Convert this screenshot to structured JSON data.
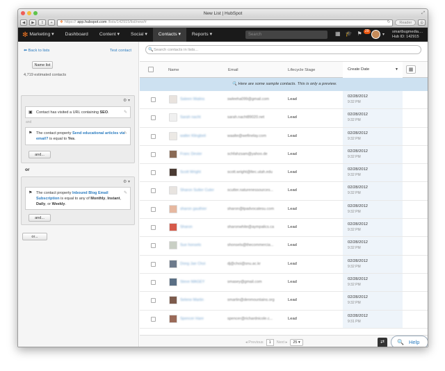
{
  "window": {
    "title": "New List | HubSpot"
  },
  "browser": {
    "protocol": "https://",
    "domain": "app.hubspot.com",
    "path": "/lists/142915/list/new/#",
    "reader_label": "Reader",
    "back": "◀",
    "forward": "▶",
    "add": "+"
  },
  "nav": {
    "logo": "Marketing",
    "items": [
      "Dashboard",
      "Content",
      "Social",
      "Contacts",
      "Reports"
    ],
    "search_placeholder": "Search",
    "notification_count": "29",
    "account_name": "smartbugmedia....",
    "hub_id": "Hub ID: 142915"
  },
  "sidebar": {
    "back_link": "Back to lists",
    "test_link": "Test contact",
    "name_button": "Name list",
    "estimate": "4,719 estimated contacts",
    "group1": {
      "cond1": {
        "prefix": "Contact has visited a URL containing ",
        "value": "SEO",
        "suffix": "."
      },
      "and_label": "and",
      "cond2": {
        "prefix": "The contact property ",
        "prop": "Send educational articles via email?",
        "mid": " is equal to ",
        "value": "Yes",
        "suffix": "."
      },
      "and_button": "and..."
    },
    "or_label": "or",
    "group2": {
      "cond1": {
        "prefix": "The contact property ",
        "prop": "Inbound Blog Email Subscription",
        "mid": " is equal to any of ",
        "v1": "Monthly",
        "sep1": ", ",
        "v2": "Instant",
        "sep2": ",",
        "v3": "Daily",
        "sep3": ", or ",
        "v4": "Weekly",
        "suffix": "."
      },
      "and_button": "and..."
    },
    "or_button": "or..."
  },
  "main": {
    "search_placeholder": "Search contacts in lists...",
    "columns": {
      "name": "Name",
      "email": "Email",
      "lifecycle": "Lifecycle Stage",
      "created": "Create Date"
    },
    "notice": "Here are some sample contacts. This is only a preview.",
    "rows": [
      {
        "name": "Saleen Watins",
        "email": "swleeha099@gmail.com",
        "lifecycle": "Lead",
        "date": "02/28/2012",
        "time": "9:32 PM",
        "color": "#e9e3de"
      },
      {
        "name": "Sarah nacht",
        "email": "sarah.nacht89020.net",
        "lifecycle": "Lead",
        "date": "02/28/2012",
        "time": "9:32 PM",
        "color": "#f0f0f0"
      },
      {
        "name": "walter Klingbeil",
        "email": "waalte@wefinelay.com",
        "lifecycle": "Lead",
        "date": "02/28/2012",
        "time": "9:32 PM",
        "color": "#ece9e5"
      },
      {
        "name": "Franc Devier",
        "email": "schfahzsam@yahoo.de",
        "lifecycle": "Lead",
        "date": "02/28/2012",
        "time": "9:32 PM",
        "color": "#8a6a55"
      },
      {
        "name": "Scott Wright",
        "email": "scott.wright@ltec.utah.edu",
        "lifecycle": "Lead",
        "date": "02/28/2012",
        "time": "9:32 PM",
        "color": "#4b3b33"
      },
      {
        "name": "Sharon Sutter Cuter",
        "email": "scutter.naturenessources...",
        "lifecycle": "Lead",
        "date": "02/28/2012",
        "time": "9:32 PM",
        "color": "#e8e4e0"
      },
      {
        "name": "sharon gauthier",
        "email": "sharon@tpadvocatesu.com",
        "lifecycle": "Lead",
        "date": "02/28/2012",
        "time": "9:32 PM",
        "color": "#e6b8a0"
      },
      {
        "name": "Sharon",
        "email": "sharonwhite@aympalics.ca",
        "lifecycle": "Lead",
        "date": "02/28/2012",
        "time": "9:32 PM",
        "color": "#d65a4a"
      },
      {
        "name": "Sue honsels",
        "email": "shonsels@thecommercia...",
        "lifecycle": "Lead",
        "date": "02/28/2012",
        "time": "9:32 PM",
        "color": "#c9cfc4"
      },
      {
        "name": "Dong Jae Choi",
        "email": "dj@choi@snu.ac.kr",
        "lifecycle": "Lead",
        "date": "02/28/2012",
        "time": "9:32 PM",
        "color": "#6e7b8c"
      },
      {
        "name": "Steve MAGEY",
        "email": "smasey@gmail.com",
        "lifecycle": "Lead",
        "date": "02/28/2012",
        "time": "9:32 PM",
        "color": "#5a6f84"
      },
      {
        "name": "Selene Martin",
        "email": "smartin@denmountains.org",
        "lifecycle": "Lead",
        "date": "02/28/2012",
        "time": "9:32 PM",
        "color": "#7d5b4c"
      },
      {
        "name": "Spencer Hare",
        "email": "spencer@richardnicole.c...",
        "lifecycle": "Lead",
        "date": "02/28/2012",
        "time": "9:31 PM",
        "color": "#9a6a58"
      }
    ]
  },
  "pager": {
    "prev": "◂ Previous",
    "page": "1",
    "next": "Next ▸",
    "per_page": "25 ▾"
  },
  "help_label": "Help",
  "colors": {
    "accent": "#f57722",
    "link": "#2a7bbf",
    "notice": "#cde1f1",
    "nav_bg": "#1a1a1a"
  }
}
